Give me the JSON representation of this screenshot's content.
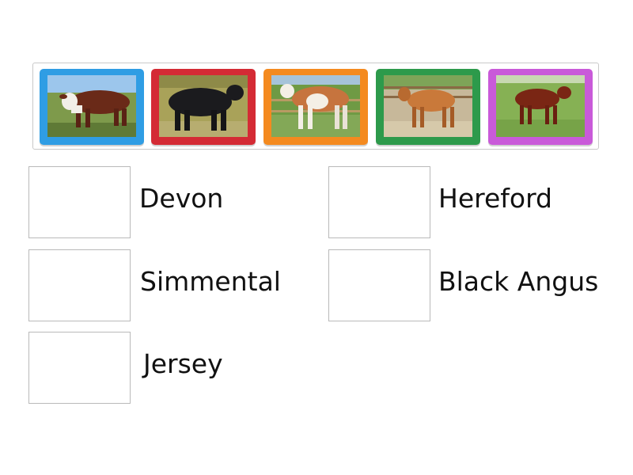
{
  "tiles": [
    {
      "name": "cow-photo-1",
      "border_color": "#2f9de4"
    },
    {
      "name": "cow-photo-2",
      "border_color": "#d42b35"
    },
    {
      "name": "cow-photo-3",
      "border_color": "#f48a1f"
    },
    {
      "name": "cow-photo-4",
      "border_color": "#2d9a4b"
    },
    {
      "name": "cow-photo-5",
      "border_color": "#c95ad9"
    }
  ],
  "answers": {
    "devon": "Devon",
    "hereford": "Hereford",
    "simmental": "Simmental",
    "black_angus": "Black Angus",
    "jersey": "Jersey"
  }
}
